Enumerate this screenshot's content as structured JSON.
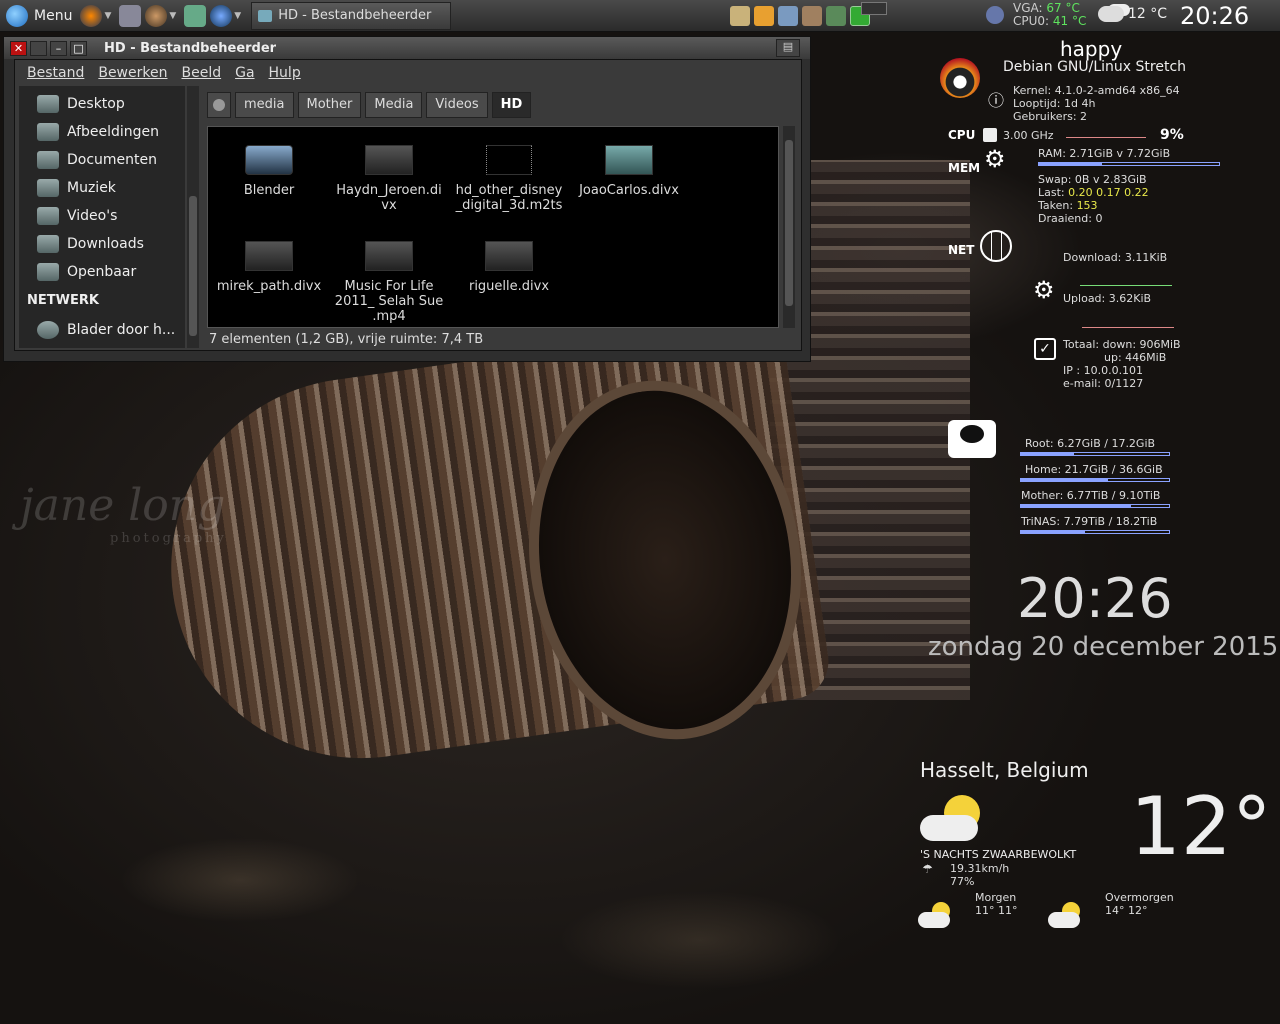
{
  "taskbar": {
    "menu_label": "Menu",
    "task_title": "HD - Bestandbeheerder",
    "sensors": {
      "vga_label": "VGA:",
      "vga_value": "67 °C",
      "cpu_label": "CPU0:",
      "cpu_value": "41 °C"
    },
    "weather_temp": "12 °C",
    "clock": "20:26"
  },
  "window": {
    "title": "HD - Bestandbeheerder",
    "menu": [
      "Bestand",
      "Bewerken",
      "Beeld",
      "Ga",
      "Hulp"
    ],
    "sidebar": {
      "places": [
        "Desktop",
        "Afbeeldingen",
        "Documenten",
        "Muziek",
        "Video's",
        "Downloads",
        "Openbaar"
      ],
      "network_heading": "NETWERK",
      "network_item": "Blader door h..."
    },
    "path": [
      "media",
      "Mother",
      "Media",
      "Videos",
      "HD"
    ],
    "files": [
      {
        "name": "Blender"
      },
      {
        "name": "Haydn_Jeroen.di vx"
      },
      {
        "name": "hd_other_disney _digital_3d.m2ts"
      },
      {
        "name": "JoaoCarlos.divx"
      },
      {
        "name": "mirek_path.divx"
      },
      {
        "name": "Music For Life 2011_ Selah Sue .mp4"
      },
      {
        "name": "riguelle.divx"
      }
    ],
    "status": "7 elementen (1,2 GB), vrije ruimte: 7,4 TB"
  },
  "watermark": {
    "text": "jane long",
    "sub": "photography"
  },
  "conky": {
    "hostname": "happy",
    "distro": "Debian GNU/Linux Stretch",
    "kernel": "Kernel: 4.1.0-2-amd64 x86_64",
    "uptime": "Looptijd: 1d 4h",
    "users": "Gebruikers: 2",
    "cpu_label": "CPU",
    "cpu_freq": "3.00 GHz",
    "cpu_pct": "9%",
    "mem_label": "MEM",
    "ram": "RAM: 2.71GiB v 7.72GiB",
    "ram_fraction": 0.35,
    "swap": "Swap: 0B   v 2.83GiB",
    "load_label": "Last:",
    "load_value": "0.20 0.17 0.22",
    "tasks_label": "Taken:",
    "tasks_value": "153",
    "running": "Draaiend: 0",
    "net_label": "NET",
    "download": "Download: 3.11KiB",
    "upload": "Upload: 3.62KiB",
    "total_down": "Totaal: down: 906MiB",
    "total_up": "up: 446MiB",
    "ip": "IP      : 10.0.0.101",
    "email": "e-mail: 0/1127",
    "disks": [
      {
        "text": "Root: 6.27GiB / 17.2GiB",
        "fraction": 0.36
      },
      {
        "text": "Home: 21.7GiB / 36.6GiB",
        "fraction": 0.59
      },
      {
        "text": "Mother: 6.77TiB / 9.10TiB",
        "fraction": 0.74
      },
      {
        "text": "TriNAS: 7.79TiB / 18.2TiB",
        "fraction": 0.43
      }
    ],
    "clock": "20:26",
    "date": "zondag 20 december 2015",
    "weather": {
      "city": "Hasselt, Belgium",
      "temp": "12°",
      "condition": "'S NACHTS ZWAARBEWOLKT",
      "wind": "19.31km/h",
      "humidity": "77%",
      "tomorrow_label": "Morgen",
      "tomorrow_temp": "11° 11°",
      "after_label": "Overmorgen",
      "after_temp": "14° 12°"
    }
  }
}
